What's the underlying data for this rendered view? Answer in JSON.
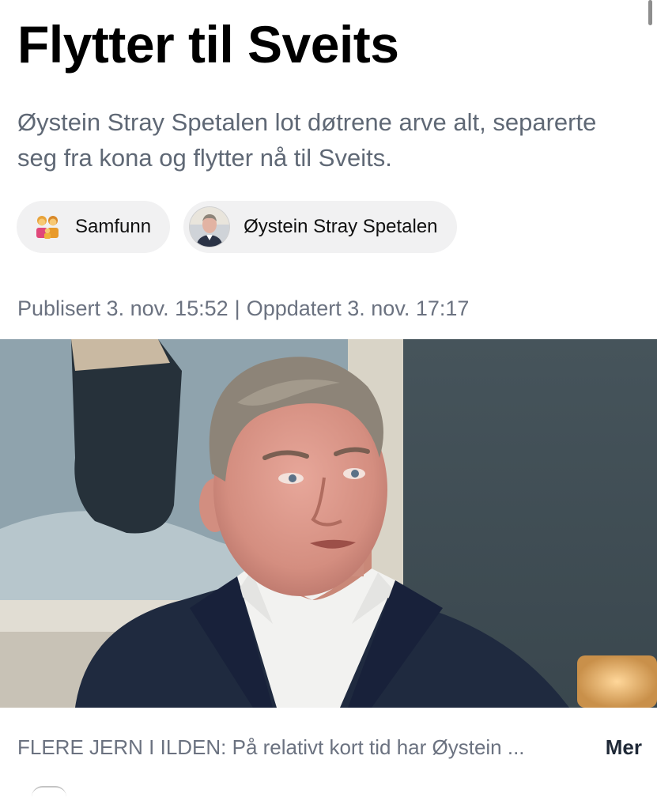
{
  "article": {
    "headline": "Flytter til Sveits",
    "lead": "Øystein Stray Spetalen lot døtrene arve alt, separerte seg fra kona og flytter nå til Sveits.",
    "tags": [
      {
        "label": "Samfunn",
        "icon": "family-emoji-icon"
      },
      {
        "label": "Øystein Stray Spetalen",
        "icon": "person-avatar"
      }
    ],
    "published": "Publisert 3. nov. 15:52",
    "separator": "|",
    "updated": "Oppdatert 3. nov. 17:17",
    "caption": "FLERE JERN I ILDEN: På relativt kort tid har Øystein ...",
    "more_label": "Mer"
  },
  "colors": {
    "lead_text": "#5f6875",
    "meta_text": "#6b7280",
    "tag_bg": "#f1f1f2"
  }
}
